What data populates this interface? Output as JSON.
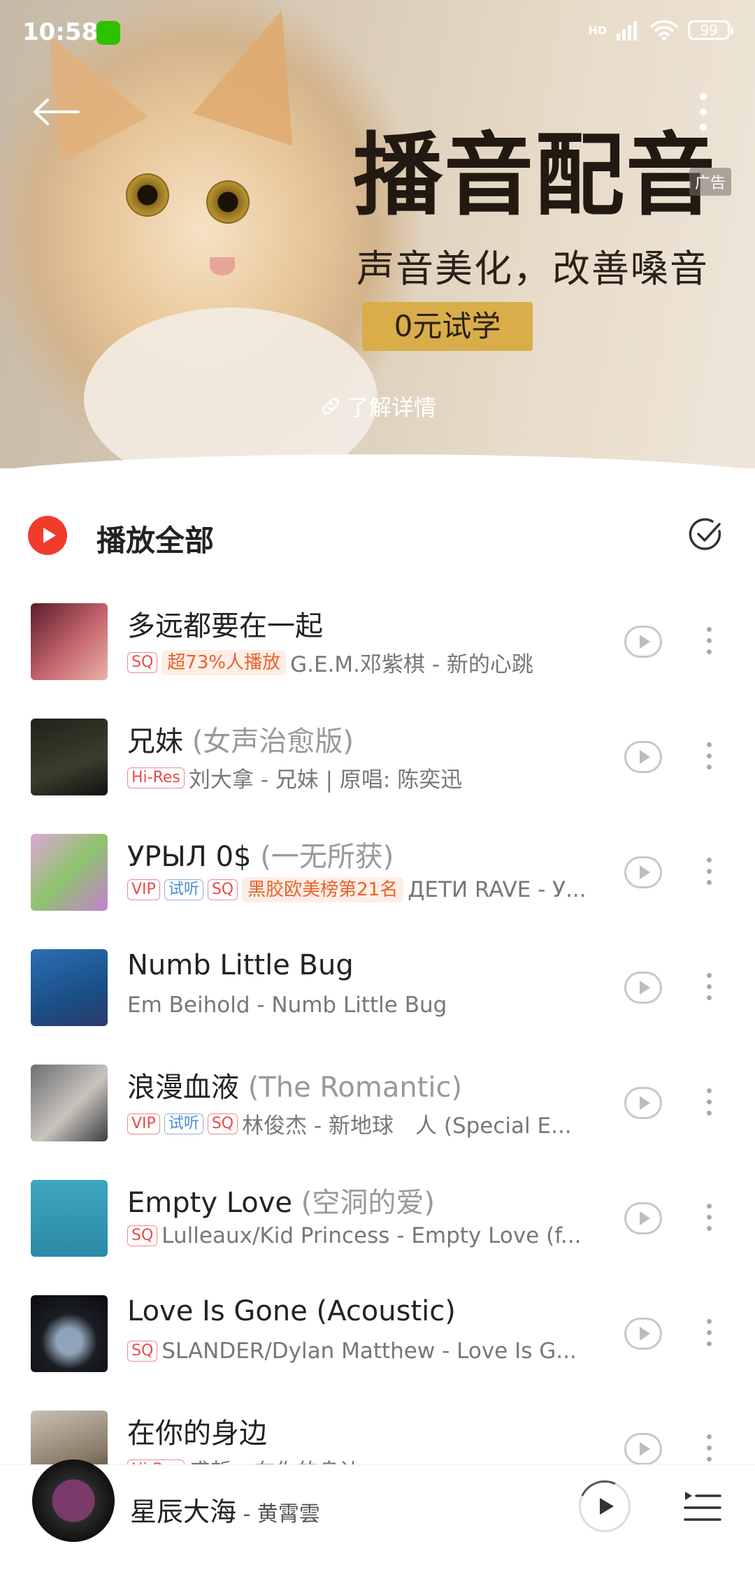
{
  "status_bar": {
    "time": "10:58",
    "network": "HD",
    "battery": "99"
  },
  "banner": {
    "title": "播音配音",
    "ad_tag": "广告",
    "subtitle": "声音美化，改善嗓音",
    "button": "0元试学",
    "link": "了解详情"
  },
  "play_all": {
    "label": "播放全部"
  },
  "songs": [
    {
      "title": "多远都要在一起",
      "alt": "",
      "tags": [
        "SQ"
      ],
      "rank": "超73%人播放",
      "meta": "G.E.M.邓紫棋 - 新的心跳"
    },
    {
      "title": "兄妹",
      "alt": "(女声治愈版)",
      "tags": [
        "Hi-Res"
      ],
      "rank": "",
      "meta": "刘大拿 - 兄妹 | 原唱: 陈奕迅"
    },
    {
      "title": "УРЫЛ 0$",
      "alt": "(一无所获)",
      "tags": [
        "VIP",
        "试听",
        "SQ"
      ],
      "rank": "黑胶欧美榜第21名",
      "meta": "ДЕТИ RAVE - У..."
    },
    {
      "title": "Numb Little Bug",
      "alt": "",
      "tags": [],
      "rank": "",
      "meta": "Em Beihold - Numb Little Bug"
    },
    {
      "title": "浪漫血液",
      "alt": "(The Romantic)",
      "tags": [
        "VIP",
        "试听",
        "SQ"
      ],
      "rank": "",
      "meta": "林俊杰 - 新地球　人 (Special E..."
    },
    {
      "title": "Empty Love",
      "alt": "(空洞的爱)",
      "tags": [
        "SQ"
      ],
      "rank": "",
      "meta": "Lulleaux/Kid Princess - Empty Love (f..."
    },
    {
      "title": "Love Is Gone (Acoustic)",
      "alt": "",
      "tags": [
        "SQ"
      ],
      "rank": "",
      "meta": "SLANDER/Dylan Matthew - Love Is G..."
    },
    {
      "title": "在你的身边",
      "alt": "",
      "tags": [
        "Hi-Res"
      ],
      "rank": "",
      "meta": "盛哲 - 在你的身边"
    }
  ],
  "now_playing": {
    "title": "星辰大海",
    "artist": "黄霄雲",
    "separator": " - "
  },
  "colors": {
    "accent": "#f13c2c",
    "ad_button": "#d9ad4a",
    "tag_red": "#e84a4a",
    "tag_blue": "#4d8ad6"
  }
}
